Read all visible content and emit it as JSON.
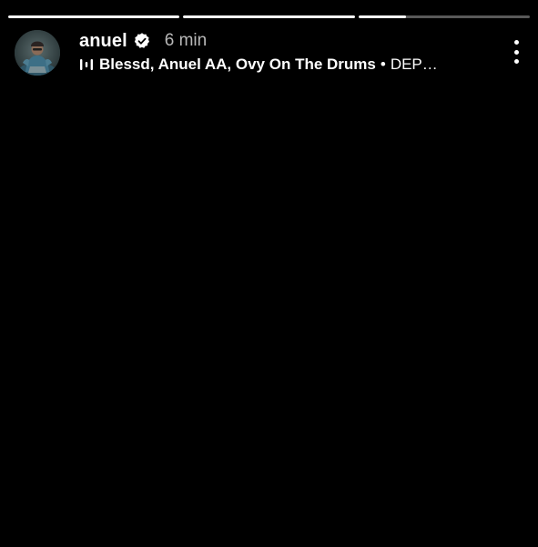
{
  "story": {
    "progress": [
      1.0,
      1.0,
      0.28
    ],
    "user": {
      "username": "anuel",
      "verified": true,
      "avatar_icon": "profile-photo-icon"
    },
    "time": "6 min",
    "music": {
      "icon": "music-equalizer-icon",
      "artists": "Blessd, Anuel AA, Ovy On The Drums",
      "separator": "•",
      "title": "DEP…"
    },
    "menu_icon": "more-vertical-icon"
  },
  "colors": {
    "background": "#000000",
    "text": "#ffffff",
    "muted": "#b8b8b8"
  }
}
